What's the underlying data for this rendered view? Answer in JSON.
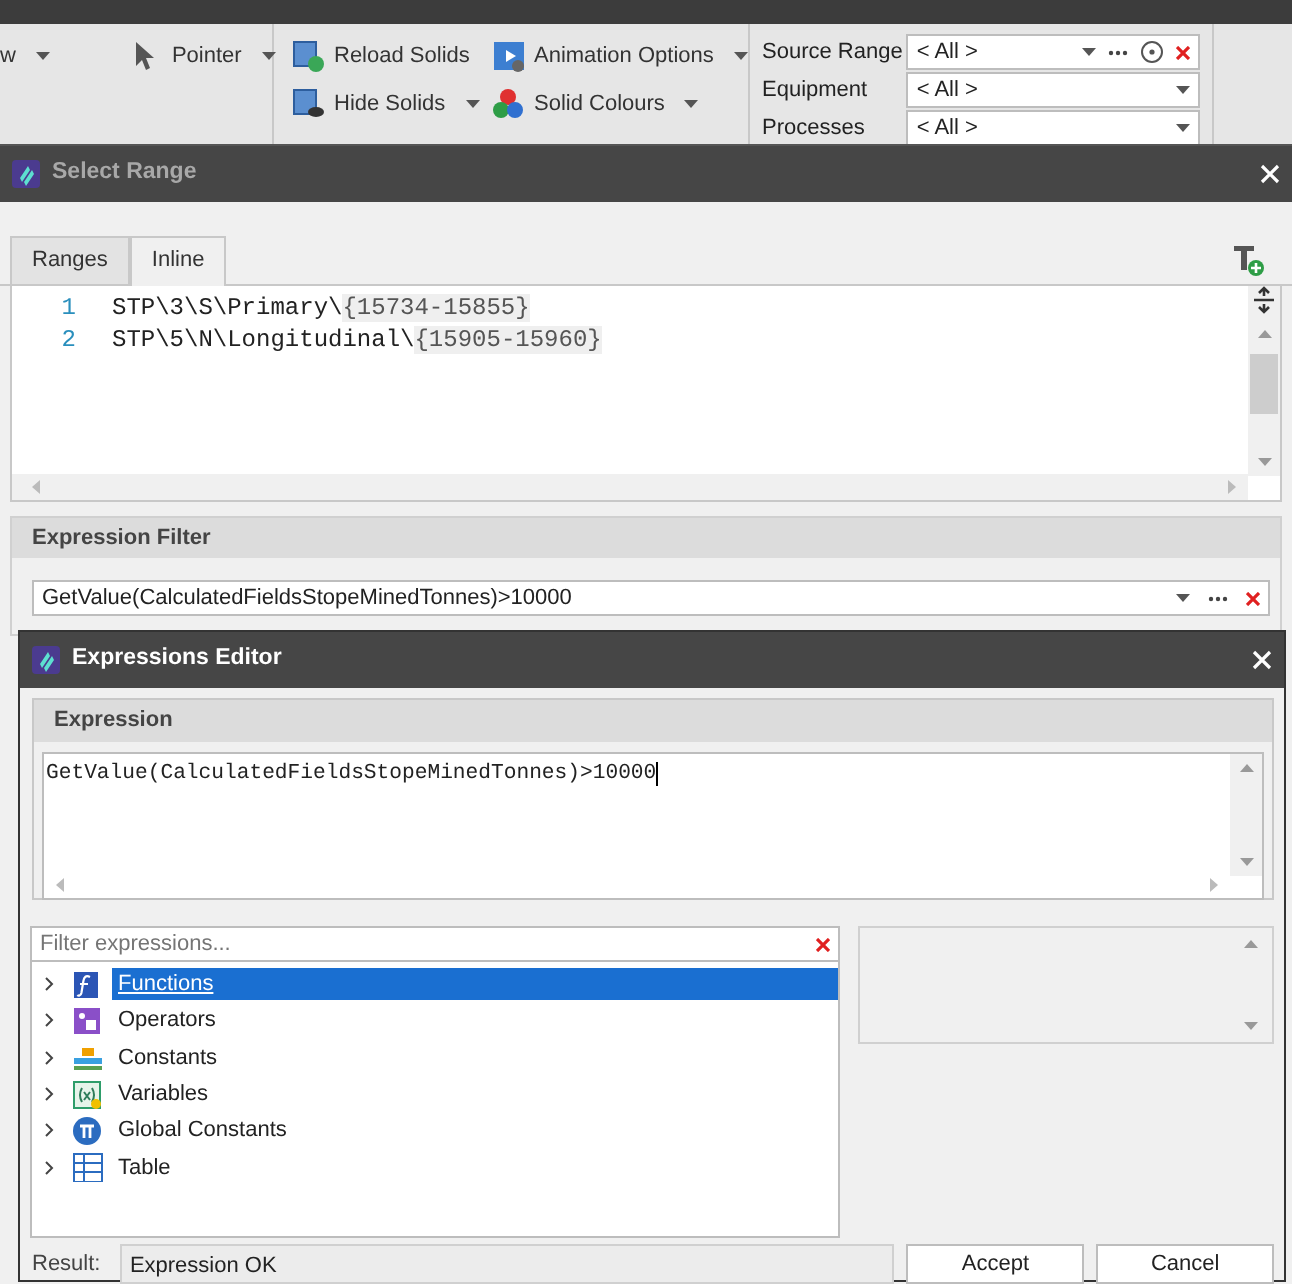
{
  "ribbon": {
    "groups": [
      {
        "items": [
          {
            "label": "w",
            "caret": true
          },
          {
            "label": "Pointer",
            "caret": true
          }
        ]
      },
      {
        "items": [
          {
            "label": "Reload Solids",
            "caret": false
          },
          {
            "label": "Hide Solids",
            "caret": true
          },
          {
            "label": "Animation Options",
            "caret": true
          },
          {
            "label": "Solid Colours",
            "caret": true
          }
        ]
      }
    ],
    "filters": [
      {
        "label": "Source Range",
        "value": "< All >",
        "extra": true
      },
      {
        "label": "Equipment",
        "value": "< All >",
        "extra": false
      },
      {
        "label": "Processes",
        "value": "< All >",
        "extra": false
      }
    ]
  },
  "select_range": {
    "title": "Select Range",
    "active": false,
    "tabs": [
      {
        "label": "Ranges",
        "selected": false
      },
      {
        "label": "Inline",
        "selected": true
      }
    ],
    "lines": [
      {
        "number": "1",
        "path": "STP\\3\\S\\Primary\\",
        "range": "{15734-15855}"
      },
      {
        "number": "2",
        "path": "STP\\5\\N\\Longitudinal\\",
        "range": "{15905-15960}"
      }
    ],
    "expression_filter": {
      "title": "Expression Filter",
      "value": "GetValue(CalculatedFieldsStopeMinedTonnes)>10000"
    }
  },
  "expressions_editor": {
    "title": "Expressions Editor",
    "active": true,
    "expression": {
      "title": "Expression",
      "value": "GetValue(CalculatedFieldsStopeMinedTonnes)>10000"
    },
    "filter": {
      "placeholder": "Filter expressions..."
    },
    "tree": [
      {
        "label": "Functions",
        "selected": true,
        "expanded": false
      },
      {
        "label": "Operators",
        "selected": false,
        "expanded": false
      },
      {
        "label": "Constants",
        "selected": false,
        "expanded": false
      },
      {
        "label": "Variables",
        "selected": false,
        "expanded": false
      },
      {
        "label": "Global Constants",
        "selected": false,
        "expanded": false
      },
      {
        "label": "Table",
        "selected": false,
        "expanded": false
      }
    ],
    "result": {
      "label": "Result:",
      "value": "Expression OK"
    },
    "buttons": [
      "Accept",
      "Cancel"
    ]
  }
}
